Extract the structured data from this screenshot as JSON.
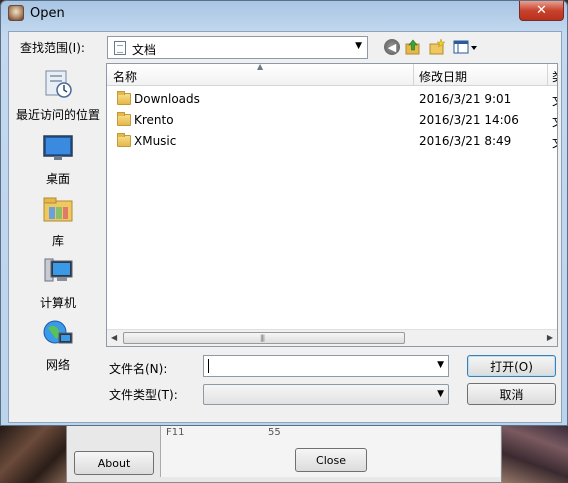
{
  "dialog": {
    "title": "Open",
    "close_glyph": "✕"
  },
  "lookin": {
    "label": "查找范围(I):",
    "value": "文档"
  },
  "toolbar": {
    "icons": [
      "back-icon",
      "up-folder-icon",
      "new-folder-icon",
      "views-menu-icon"
    ]
  },
  "places": [
    {
      "label": "最近访问的位置",
      "icon": "recent-places-icon"
    },
    {
      "label": "桌面",
      "icon": "desktop-icon"
    },
    {
      "label": "库",
      "icon": "library-icon"
    },
    {
      "label": "计算机",
      "icon": "computer-icon"
    },
    {
      "label": "网络",
      "icon": "network-icon"
    }
  ],
  "filelist": {
    "columns": {
      "name": "名称",
      "date": "修改日期",
      "type": "类"
    },
    "rows": [
      {
        "name": "Downloads",
        "date": "2016/3/21 9:01",
        "type": "文"
      },
      {
        "name": "Krento",
        "date": "2016/3/21 14:06",
        "type": "文"
      },
      {
        "name": "XMusic",
        "date": "2016/3/21 8:49",
        "type": "文"
      }
    ]
  },
  "filename": {
    "label": "文件名(N):",
    "value": ""
  },
  "filetype": {
    "label": "文件类型(T):",
    "value": ""
  },
  "buttons": {
    "open": "打开(O)",
    "cancel": "取消"
  },
  "background_window": {
    "about": "About",
    "close": "Close",
    "cell_a": "F11",
    "cell_b": "55"
  },
  "colors": {
    "title_bar": "#b9d1ea",
    "close_button": "#c8432d",
    "folder": "#e6b84a"
  }
}
